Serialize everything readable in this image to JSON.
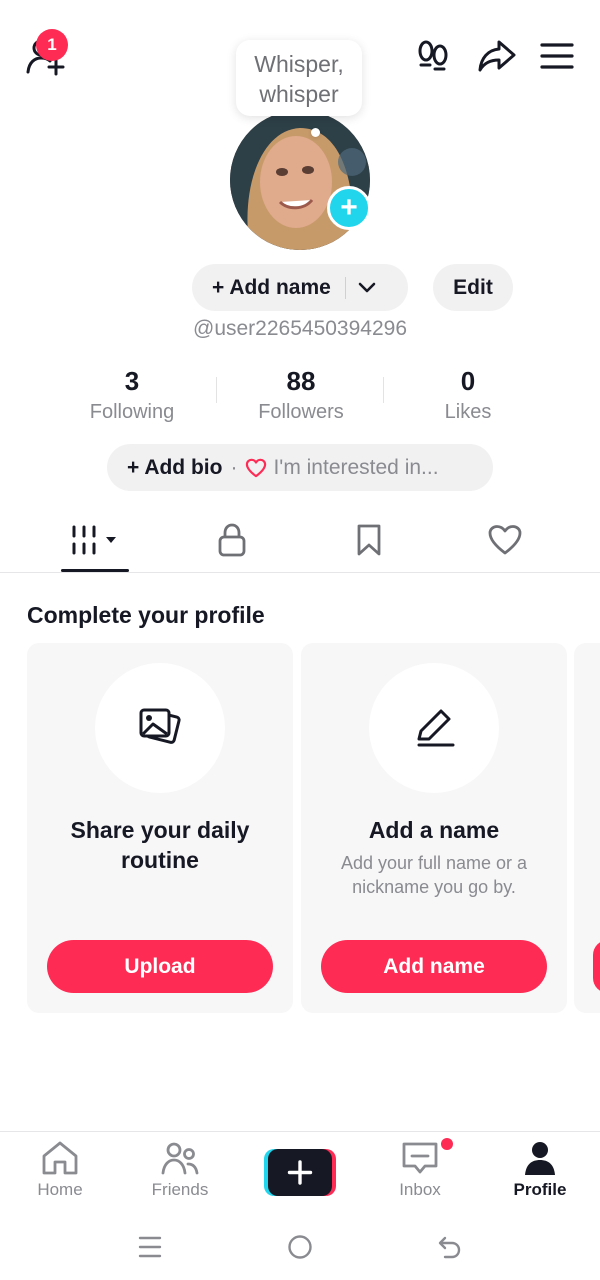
{
  "topbar": {
    "add_friends_badge": "1",
    "whisper_bubble_line1": "Whisper,",
    "whisper_bubble_line2": "whisper"
  },
  "profile": {
    "add_name_label": "+ Add name",
    "edit_label": "Edit",
    "username": "@user2265450394296",
    "stats": [
      {
        "value": "3",
        "label": "Following"
      },
      {
        "value": "88",
        "label": "Followers"
      },
      {
        "value": "0",
        "label": "Likes"
      }
    ],
    "add_bio_label": "+ Add bio",
    "bio_separator": "·",
    "interest_label": "I'm interested in..."
  },
  "tabs": [
    "videos-grid",
    "private",
    "favorites",
    "liked"
  ],
  "complete_profile": {
    "title": "Complete your profile",
    "cards": [
      {
        "title": "Share your daily routine",
        "subtitle": "",
        "button": "Upload",
        "icon": "photos-icon"
      },
      {
        "title": "Add a name",
        "subtitle": "Add your full name or a nickname you go by.",
        "button": "Add name",
        "icon": "pencil-icon"
      }
    ]
  },
  "bottom_nav": {
    "items": [
      "Home",
      "Friends",
      "",
      "Inbox",
      "Profile"
    ],
    "active": "Profile"
  },
  "colors": {
    "accent": "#fe2c55",
    "cyan": "#20d5ec",
    "text": "#161823",
    "muted": "#8a8b91",
    "pill_bg": "#f1f1f2"
  }
}
